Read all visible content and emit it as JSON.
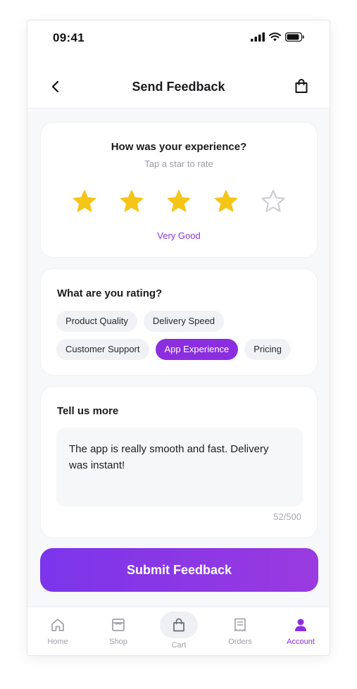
{
  "status_bar": {
    "time": "09:41"
  },
  "header": {
    "title": "Send Feedback"
  },
  "rating": {
    "question": "How was your experience?",
    "hint": "Tap a star to rate",
    "value": 4,
    "max": 5,
    "label": "Very Good"
  },
  "topics": {
    "title": "What are you rating?",
    "row1": [
      {
        "label": "Product Quality",
        "selected": false
      },
      {
        "label": "Delivery Speed",
        "selected": false
      }
    ],
    "row2": [
      {
        "label": "Customer Support",
        "selected": false
      },
      {
        "label": "App Experience",
        "selected": true
      },
      {
        "label": "Pricing",
        "selected": false
      }
    ]
  },
  "more": {
    "title": "Tell us more",
    "text": "The app is really smooth and fast. Delivery was instant!",
    "counter": "52/500"
  },
  "submit_label": "Submit Feedback",
  "nav": {
    "home": "Home",
    "shop": "Shop",
    "cart": "Cart",
    "orders": "Orders",
    "account": "Account"
  },
  "colors": {
    "accent": "#8b2ee0",
    "star_filled": "#f5c518",
    "star_empty": "#c9cbd1"
  }
}
